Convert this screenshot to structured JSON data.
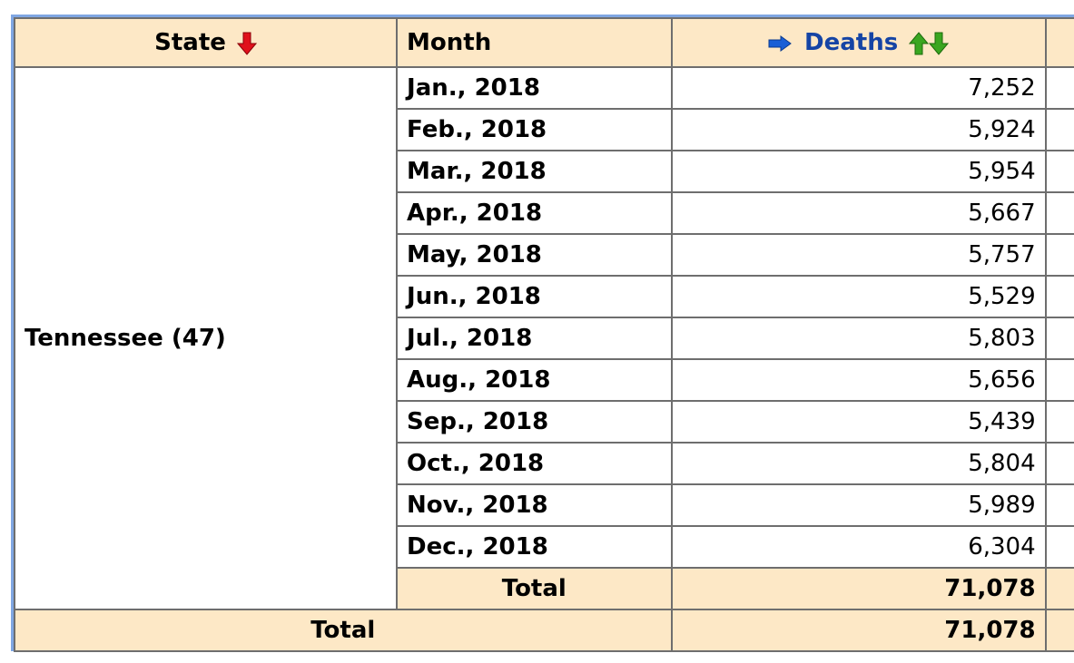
{
  "table": {
    "headers": {
      "state": "State",
      "month": "Month",
      "deaths": "Deaths"
    },
    "icons": {
      "state_sort": "sort-descending-red-arrow-icon",
      "deaths_indicator": "right-arrow-blue-icon",
      "deaths_sort": "sort-up-down-green-arrows-icon"
    },
    "colors": {
      "header_bg": "#fde8c6",
      "border": "#7fa6e2",
      "deaths_header_text": "#1544a5",
      "sort_red": "#e0111b",
      "sort_green": "#3aa620"
    },
    "state": "Tennessee (47)",
    "rows": [
      {
        "month": "Jan., 2018",
        "deaths": "7,252"
      },
      {
        "month": "Feb., 2018",
        "deaths": "5,924"
      },
      {
        "month": "Mar., 2018",
        "deaths": "5,954"
      },
      {
        "month": "Apr., 2018",
        "deaths": "5,667"
      },
      {
        "month": "May, 2018",
        "deaths": "5,757"
      },
      {
        "month": "Jun., 2018",
        "deaths": "5,529"
      },
      {
        "month": "Jul., 2018",
        "deaths": "5,803"
      },
      {
        "month": "Aug., 2018",
        "deaths": "5,656"
      },
      {
        "month": "Sep., 2018",
        "deaths": "5,439"
      },
      {
        "month": "Oct., 2018",
        "deaths": "5,804"
      },
      {
        "month": "Nov., 2018",
        "deaths": "5,989"
      },
      {
        "month": "Dec., 2018",
        "deaths": "6,304"
      }
    ],
    "state_total_label": "Total",
    "state_total_value": "71,078",
    "grand_total_label": "Total",
    "grand_total_value": "71,078"
  }
}
